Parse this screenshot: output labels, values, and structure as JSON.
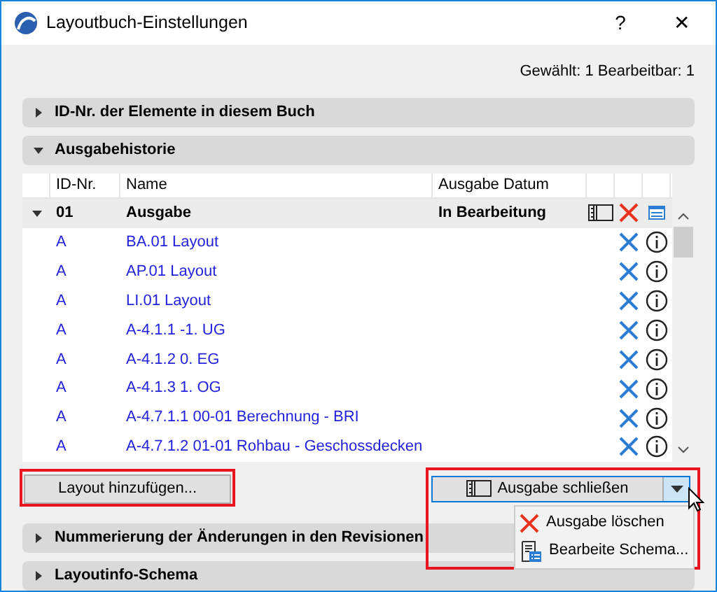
{
  "window": {
    "title": "Layoutbuch-Einstellungen",
    "help": "?",
    "close": "✕"
  },
  "status": "Gewählt: 1 Bearbeitbar: 1",
  "sections": [
    {
      "title": "ID-Nr. der Elemente in diesem Buch",
      "expanded": false
    },
    {
      "title": "Ausgabehistorie",
      "expanded": true,
      "table": {
        "columns": [
          "ID-Nr.",
          "Name",
          "Ausgabe Datum"
        ],
        "group": {
          "id": "01",
          "name": "Ausgabe",
          "status": "In Bearbeitung",
          "expanded": true
        },
        "rows": [
          {
            "id": "A",
            "name": "BA.01 Layout"
          },
          {
            "id": "A",
            "name": "AP.01 Layout"
          },
          {
            "id": "A",
            "name": "LI.01 Layout"
          },
          {
            "id": "A",
            "name": "A-4.1.1 -1. UG"
          },
          {
            "id": "A",
            "name": "A-4.1.2 0. EG"
          },
          {
            "id": "A",
            "name": "A-4.1.3 1. OG"
          },
          {
            "id": "A",
            "name": "A-4.7.1.1 00-01 Berechnung - BRI"
          },
          {
            "id": "A",
            "name": "A-4.7.1.2 01-01 Rohbau - Geschossdecken"
          }
        ]
      },
      "add_button": "Layout hinzufügen...",
      "split_button": {
        "label": "Ausgabe schließen",
        "menu_open": true,
        "menu": [
          {
            "kind": "delete",
            "label": "Ausgabe löschen"
          },
          {
            "kind": "schema",
            "label": "Bearbeite Schema..."
          }
        ]
      }
    },
    {
      "title": "Nummerierung der Änderungen in den Revisionen",
      "expanded": false
    },
    {
      "title": "Layoutinfo-Schema",
      "expanded": false
    }
  ]
}
